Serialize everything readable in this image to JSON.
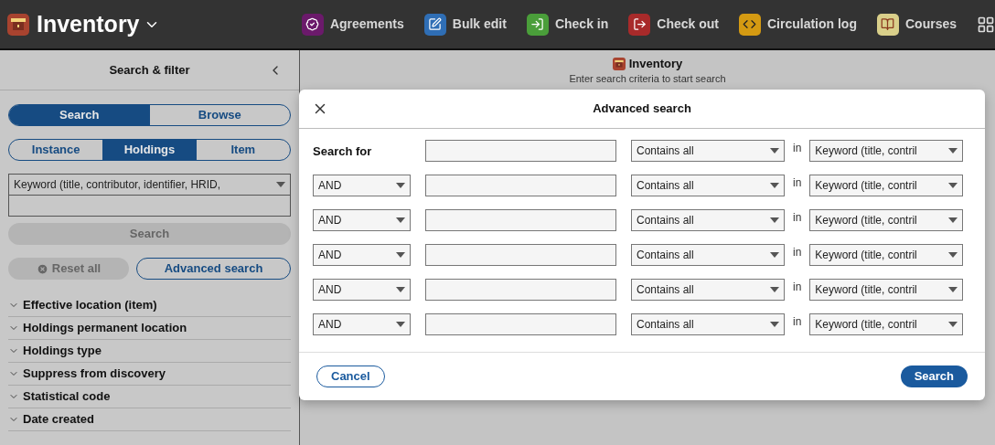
{
  "header": {
    "app_title": "Inventory",
    "apps": [
      {
        "label": "Agreements",
        "color": "#6b1a6b"
      },
      {
        "label": "Bulk edit",
        "color": "#2f6eb5"
      },
      {
        "label": "Check in",
        "color": "#4a9e3a"
      },
      {
        "label": "Check out",
        "color": "#a82a2a"
      },
      {
        "label": "Circulation log",
        "color": "#d49a12"
      },
      {
        "label": "Courses",
        "color": "#d9cf8a"
      }
    ]
  },
  "sidebar": {
    "title": "Search & filter",
    "mode_tabs": [
      {
        "label": "Search",
        "selected": true
      },
      {
        "label": "Browse",
        "selected": false
      }
    ],
    "segment_tabs": [
      {
        "label": "Instance",
        "selected": false
      },
      {
        "label": "Holdings",
        "selected": true
      },
      {
        "label": "Item",
        "selected": false
      }
    ],
    "search_option": "Keyword (title, contributor, identifier, HRID,",
    "search_button": "Search",
    "reset_button": "Reset all",
    "advanced_button": "Advanced search",
    "filters": [
      {
        "label": "Effective location (item)",
        "expanded": false
      },
      {
        "label": "Holdings permanent location",
        "expanded": false
      },
      {
        "label": "Holdings type",
        "expanded": false
      },
      {
        "label": "Suppress from discovery",
        "expanded": false
      },
      {
        "label": "Statistical code",
        "expanded": false
      },
      {
        "label": "Date created",
        "expanded": false
      }
    ]
  },
  "results": {
    "title": "Inventory",
    "message": "Enter search criteria to start search"
  },
  "modal": {
    "title": "Advanced search",
    "rows": [
      {
        "kind": "first",
        "label": "Search for",
        "match": "Contains all",
        "in": "in",
        "field": "Keyword (title, contril"
      },
      {
        "kind": "operator",
        "operator": "AND",
        "match": "Contains all",
        "in": "in",
        "field": "Keyword (title, contril"
      },
      {
        "kind": "operator",
        "operator": "AND",
        "match": "Contains all",
        "in": "in",
        "field": "Keyword (title, contril"
      },
      {
        "kind": "operator",
        "operator": "AND",
        "match": "Contains all",
        "in": "in",
        "field": "Keyword (title, contril"
      },
      {
        "kind": "operator",
        "operator": "AND",
        "match": "Contains all",
        "in": "in",
        "field": "Keyword (title, contril"
      },
      {
        "kind": "operator",
        "operator": "AND",
        "match": "Contains all",
        "in": "in",
        "field": "Keyword (title, contril"
      }
    ],
    "cancel": "Cancel",
    "search": "Search"
  }
}
